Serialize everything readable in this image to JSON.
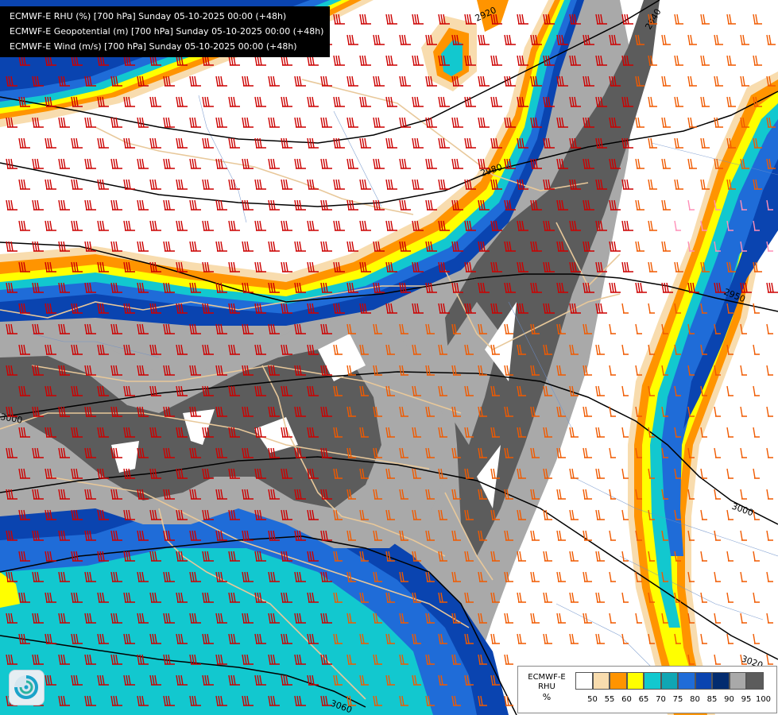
{
  "titles": [
    "ECMWF-E RHU (%) [700 hPa] Sunday 05-10-2025 00:00 (+48h)",
    "ECMWF-E Geopotential (m) [700 hPa] Sunday 05-10-2025 00:00 (+48h)",
    "ECMWF-E Wind (m/s) [700 hPa] Sunday 05-10-2025 00:00 (+48h)"
  ],
  "legend": {
    "model": "ECMWF-E",
    "variable": "RHU",
    "unit": "%",
    "levels": [
      "50",
      "55",
      "60",
      "65",
      "70",
      "75",
      "80",
      "85",
      "90",
      "95",
      "100"
    ],
    "colors": [
      "#ffffff",
      "#f8dcae",
      "#ff9400",
      "#ffff00",
      "#12c8cf",
      "#10a6b4",
      "#1f6cd8",
      "#0a44b0",
      "#032c6f",
      "#a9a9a9",
      "#5c5c5c"
    ]
  },
  "contour_labels": [
    "2920",
    "2940",
    "2980",
    "2950",
    "3000",
    "3000",
    "3020",
    "3060"
  ],
  "logo_icon": "ecmwf-swirl-icon"
}
